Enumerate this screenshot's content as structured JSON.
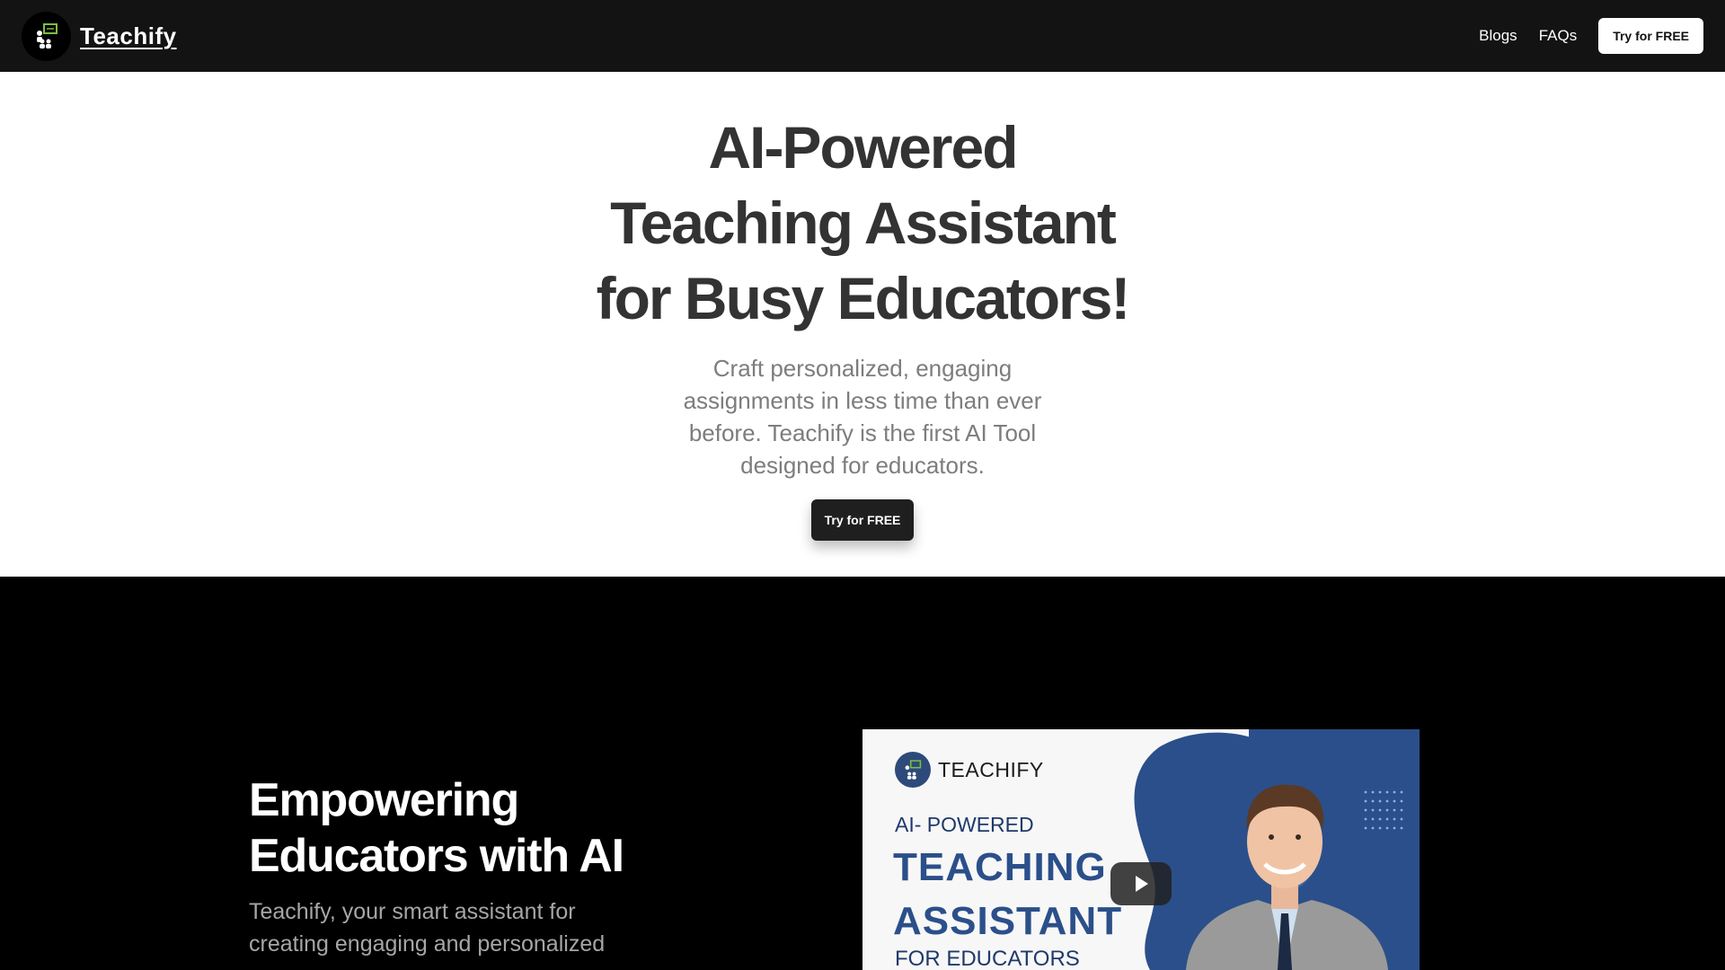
{
  "nav": {
    "brand": "Teachify",
    "links": [
      {
        "label": "Blogs"
      },
      {
        "label": "FAQs"
      }
    ],
    "cta_label": "Try for FREE"
  },
  "hero": {
    "title_lines": [
      "AI-Powered",
      "Teaching Assistant",
      "for Busy Educators!"
    ],
    "subtitle": "Craft personalized, engaging assignments in less time than ever before. Teachify is the first AI Tool designed for educators.",
    "cta_label": "Try for FREE"
  },
  "feature": {
    "title_lines": [
      "Empowering",
      "Educators with AI"
    ],
    "description": "Teachify, your smart assistant for creating engaging and personalized"
  },
  "video": {
    "brand": "TEACHIFY",
    "line1": "AI- POWERED",
    "line2a": "TEACHING",
    "line2b": "ASSISTANT",
    "line3": "FOR EDUCATORS"
  },
  "colors": {
    "nav_bg": "#131313",
    "dark_section_bg": "#000000",
    "thumbnail_blue": "#2b4f8a",
    "logo_green": "#7bc043"
  }
}
